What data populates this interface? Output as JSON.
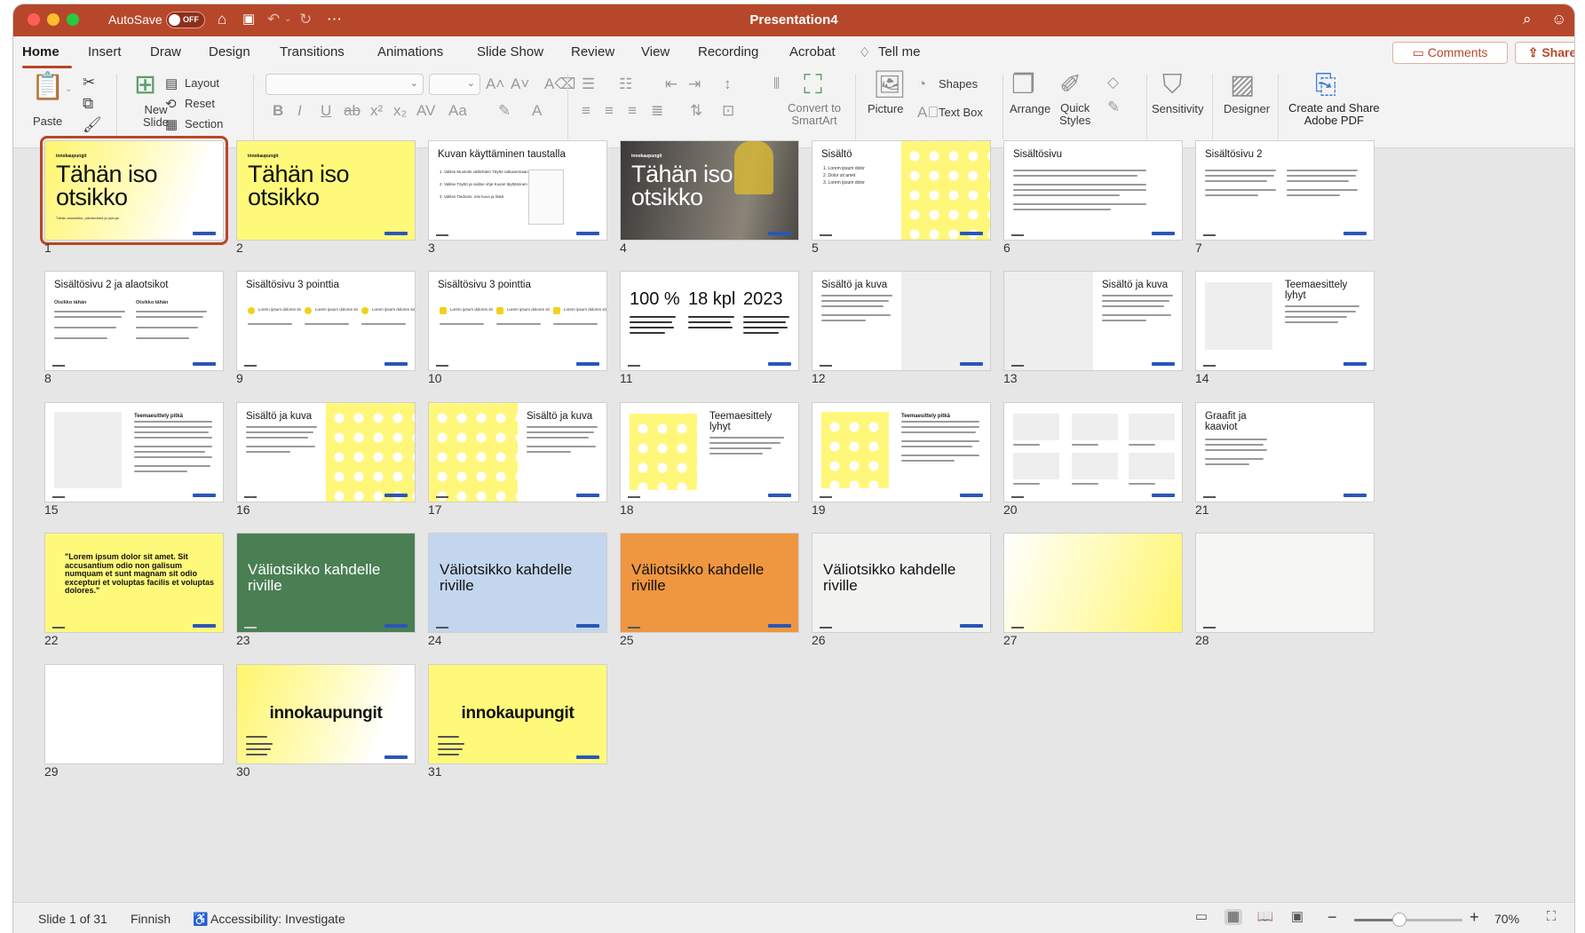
{
  "window": {
    "title": "Presentation4",
    "autosave_label": "AutoSave",
    "autosave_state": "OFF"
  },
  "tabs": [
    "Home",
    "Insert",
    "Draw",
    "Design",
    "Transitions",
    "Animations",
    "Slide Show",
    "Review",
    "View",
    "Recording",
    "Acrobat"
  ],
  "tell_me": "Tell me",
  "header_buttons": {
    "comments": "Comments",
    "share": "Share"
  },
  "ribbon": {
    "paste": "Paste",
    "new_slide": "New\nSlide",
    "layout": "Layout",
    "reset": "Reset",
    "section": "Section",
    "convert_smartart": "Convert to\nSmartArt",
    "picture": "Picture",
    "shapes": "Shapes",
    "text_box": "Text Box",
    "arrange": "Arrange",
    "quick_styles": "Quick\nStyles",
    "sensitivity": "Sensitivity",
    "designer": "Designer",
    "create_share_pdf": "Create and Share\nAdobe PDF"
  },
  "slides": [
    {
      "n": "1",
      "micro": "innokaupungit",
      "big": "Tähän iso otsikko",
      "sub": "Tähän alaotsikko, päivämäärä ja puhuja"
    },
    {
      "n": "2",
      "micro": "innokaupungit",
      "big": "Tähän iso otsikko"
    },
    {
      "n": "3",
      "title": "Kuvan käyttäminen taustalla",
      "items": [
        "1. Valitse Muotoile välilehden Täyttö ratkaisemaan",
        "2. Valitse Täyttö ja valitse ohje Kuvan täyttäminen",
        "3. Valitse Tiedosto, etsi kuva ja lisää"
      ]
    },
    {
      "n": "4",
      "micro": "innokaupungit",
      "big": "Tähän iso otsikko"
    },
    {
      "n": "5",
      "title": "Sisältö",
      "items": [
        "1. Lorem ipsum dolor",
        "2. Dolor sit amet",
        "3. Lorem ipsum dolor"
      ]
    },
    {
      "n": "6",
      "title": "Sisältösivu"
    },
    {
      "n": "7",
      "title": "Sisältösivu 2"
    },
    {
      "n": "8",
      "title": "Sisältösivu 2 ja alaotsikot",
      "col1": "Otsikko tähän",
      "col2": "Otsikko tähän"
    },
    {
      "n": "9",
      "title": "Sisältösivu 3 pointtia",
      "points": [
        "1",
        "2",
        "3"
      ],
      "point_text": "Lorem ipsum dolores sit"
    },
    {
      "n": "10",
      "title": "Sisältösivu 3 pointtia",
      "point_text": "Lorem ipsum dolores sit"
    },
    {
      "n": "11",
      "stats": [
        "100 %",
        "18 kpl",
        "2023"
      ]
    },
    {
      "n": "12",
      "title": "Sisältö ja kuva"
    },
    {
      "n": "13",
      "title": "Sisältö ja kuva"
    },
    {
      "n": "14",
      "title": "Teemaesittely lyhyt"
    },
    {
      "n": "15",
      "title": "Teemaesittely pitkä"
    },
    {
      "n": "16",
      "title": "Sisältö ja kuva"
    },
    {
      "n": "17",
      "title": "Sisältö ja kuva"
    },
    {
      "n": "18",
      "title": "Teemaesittely lyhyt"
    },
    {
      "n": "19",
      "title": "Teemaesittely pitkä"
    },
    {
      "n": "20"
    },
    {
      "n": "21",
      "title": "Graafit ja kaaviot"
    },
    {
      "n": "22",
      "quote": "\"Lorem ipsum dolor sit amet. Sit accusantium odio non galisum numquam et sunt magnam sit odio excepturi et voluptas facilis et voluptas dolores.\""
    },
    {
      "n": "23",
      "section": "Väliotsikko kahdelle riville",
      "color": "#4a7f53"
    },
    {
      "n": "24",
      "section": "Väliotsikko kahdelle riville",
      "color": "#c3d6ee"
    },
    {
      "n": "25",
      "section": "Väliotsikko kahdelle riville",
      "color": "#ef9640"
    },
    {
      "n": "26",
      "section": "Väliotsikko kahdelle riville",
      "color": "#f2f3f1"
    },
    {
      "n": "27"
    },
    {
      "n": "28"
    },
    {
      "n": "29"
    },
    {
      "n": "30",
      "logo": "innokaupungit"
    },
    {
      "n": "31",
      "logo": "innokaupungit"
    }
  ],
  "status": {
    "slide": "Slide 1 of 31",
    "language": "Finnish",
    "accessibility": "Accessibility: Investigate",
    "zoom": "70%",
    "zoom_fraction": 0.42
  },
  "colors": {
    "accent": "#b7472a",
    "selected_outline": "#b7472a",
    "slide_yellow": "#fff97a"
  }
}
